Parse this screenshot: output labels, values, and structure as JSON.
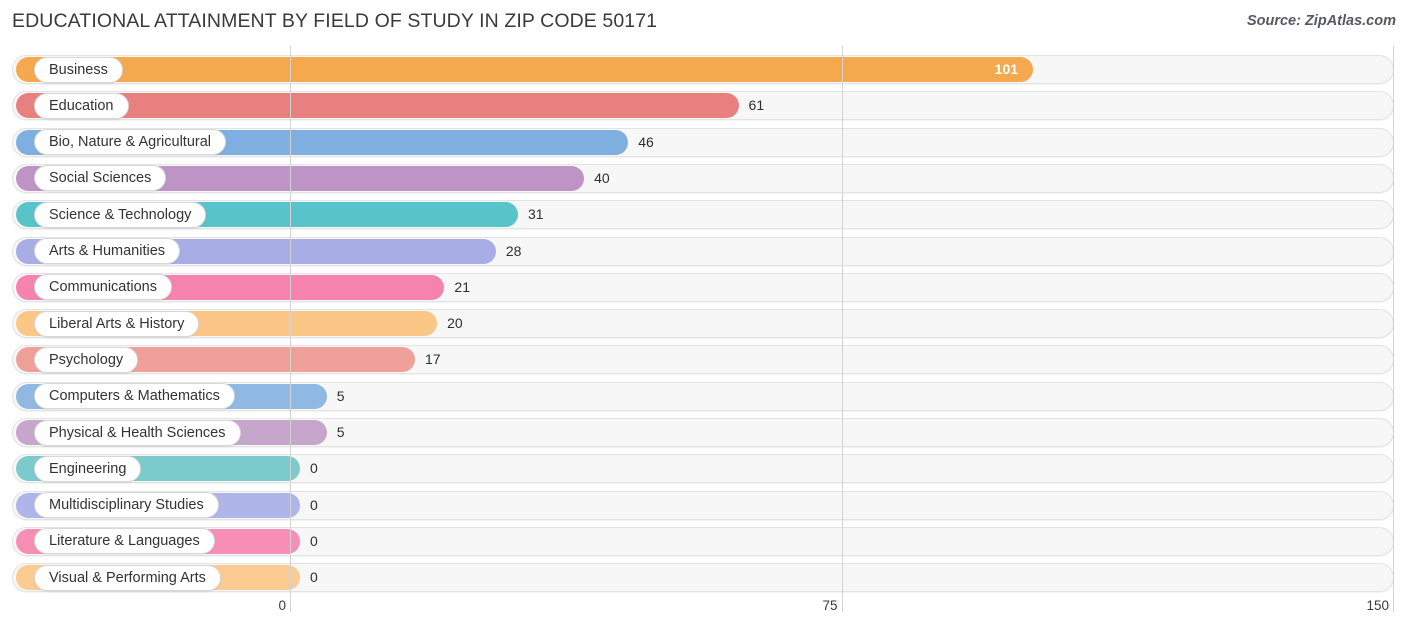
{
  "header": {
    "title": "EDUCATIONAL ATTAINMENT BY FIELD OF STUDY IN ZIP CODE 50171",
    "source": "Source: ZipAtlas.com"
  },
  "chart_data": {
    "type": "bar",
    "orientation": "horizontal",
    "title": "EDUCATIONAL ATTAINMENT BY FIELD OF STUDY IN ZIP CODE 50171",
    "xlabel": "",
    "ylabel": "",
    "xlim": [
      0,
      150
    ],
    "xticks": [
      0,
      75,
      150
    ],
    "xtick_labels": [
      "0",
      "75",
      "150"
    ],
    "grid": true,
    "legend": false,
    "categories": [
      "Business",
      "Education",
      "Bio, Nature & Agricultural",
      "Social Sciences",
      "Science & Technology",
      "Arts & Humanities",
      "Communications",
      "Liberal Arts & History",
      "Psychology",
      "Computers & Mathematics",
      "Physical & Health Sciences",
      "Engineering",
      "Multidisciplinary Studies",
      "Literature & Languages",
      "Visual & Performing Arts"
    ],
    "values": [
      101,
      61,
      46,
      40,
      31,
      28,
      21,
      20,
      17,
      5,
      5,
      0,
      0,
      0,
      0
    ],
    "value_labels": [
      "101",
      "61",
      "46",
      "40",
      "31",
      "28",
      "21",
      "20",
      "17",
      "5",
      "5",
      "0",
      "0",
      "0",
      "0"
    ],
    "colors": [
      "#F5A94F",
      "#E98080",
      "#7FAEE0",
      "#BE93C6",
      "#58C3C8",
      "#A8AEE5",
      "#F583AE",
      "#FBC787",
      "#EFA099",
      "#8FB8E3",
      "#C7A6CC",
      "#7BCBCD",
      "#AFB5E8",
      "#F78FB5",
      "#FBCB92"
    ]
  },
  "axis": {
    "ticks": [
      {
        "label": "0",
        "value": 0
      },
      {
        "label": "75",
        "value": 75
      },
      {
        "label": "150",
        "value": 150
      }
    ]
  }
}
